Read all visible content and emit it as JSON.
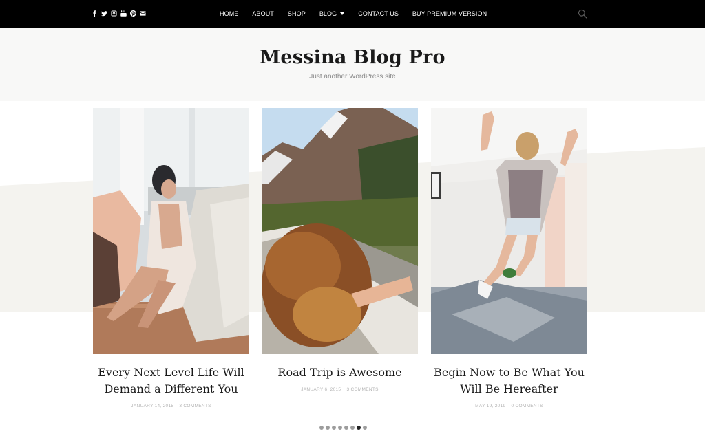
{
  "social_icons": [
    "facebook-icon",
    "twitter-icon",
    "instagram-icon",
    "youtube-icon",
    "pinterest-icon",
    "email-icon"
  ],
  "nav": {
    "items": [
      {
        "label": "HOME"
      },
      {
        "label": "ABOUT"
      },
      {
        "label": "SHOP"
      },
      {
        "label": "BLOG",
        "has_dropdown": true
      },
      {
        "label": "CONTACT US"
      },
      {
        "label": "BUY PREMIUM VERSION"
      }
    ],
    "search_icon": "search-icon"
  },
  "header": {
    "site_title": "Messina Blog Pro",
    "tagline": "Just another WordPress site"
  },
  "posts": [
    {
      "title_line1": "Every Next Level Life Will",
      "title_line2": "Demand a Different You",
      "date": "JANUARY 14, 2015",
      "comments": "3 COMMENTS"
    },
    {
      "title_line1": "Road Trip is Awesome",
      "title_line2": "",
      "date": "JANUARY 6, 2015",
      "comments": "3 COMMENTS"
    },
    {
      "title_line1": "Begin Now to Be What You",
      "title_line2": "Will Be Hereafter",
      "date": "MAY 19, 2019",
      "comments": "0 COMMENTS"
    }
  ],
  "pagination": {
    "count": 8,
    "active_index": 6
  },
  "colors": {
    "topbar_bg": "#000000",
    "header_bg": "#f8f8f7",
    "band_bg": "#f4f3ef",
    "dot_inactive": "#9d9d9d",
    "dot_active": "#222222"
  }
}
